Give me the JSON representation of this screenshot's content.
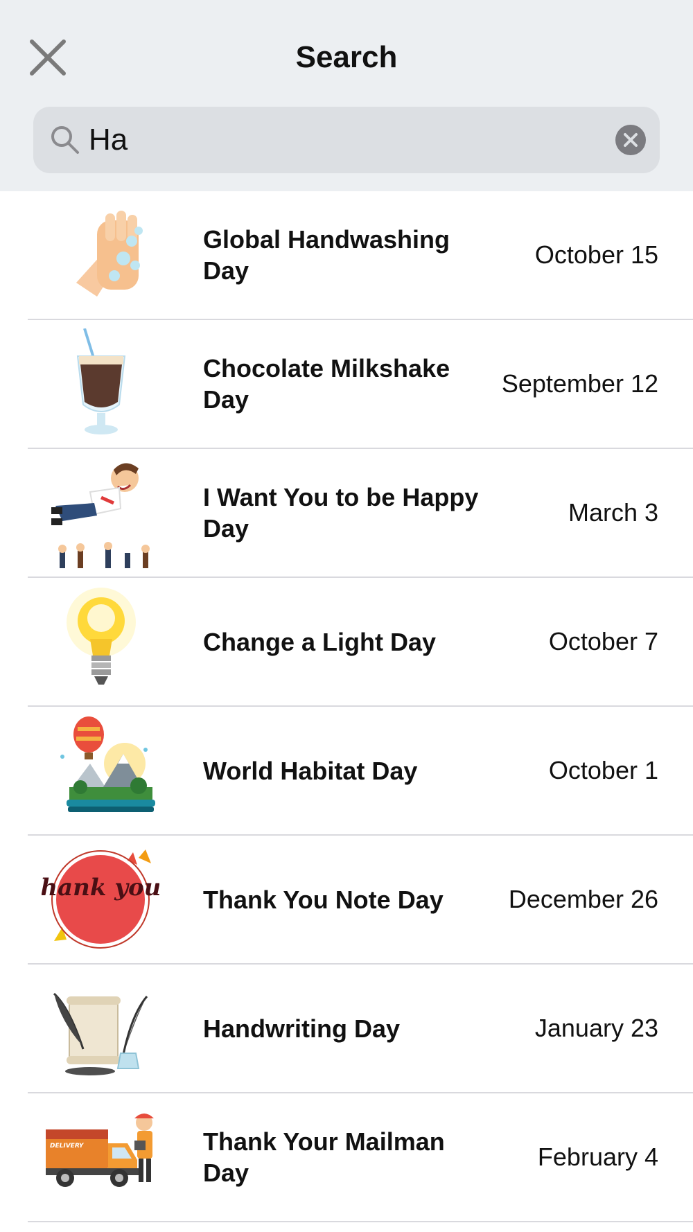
{
  "header": {
    "title": "Search",
    "close_icon": "close-icon"
  },
  "search": {
    "icon": "search-icon",
    "value": "Ha",
    "clear_icon": "clear-circle-icon"
  },
  "results": [
    {
      "name": "Global Handwashing Day",
      "date": "October 15",
      "icon": "handwashing-hands-icon"
    },
    {
      "name": "Chocolate Milkshake Day",
      "date": "September 12",
      "icon": "milkshake-glass-icon"
    },
    {
      "name": "I Want You to be Happy Day",
      "date": "March 3",
      "icon": "happy-man-thrown-icon"
    },
    {
      "name": "Change a Light Day",
      "date": "October 7",
      "icon": "lightbulb-icon"
    },
    {
      "name": "World Habitat Day",
      "date": "October 1",
      "icon": "habitat-island-icon"
    },
    {
      "name": "Thank You Note Day",
      "date": "December 26",
      "icon": "thank-you-badge-icon"
    },
    {
      "name": "Handwriting Day",
      "date": "January 23",
      "icon": "quill-scroll-icon"
    },
    {
      "name": "Thank Your Mailman Day",
      "date": "February 4",
      "icon": "delivery-truck-icon"
    }
  ],
  "colors": {
    "header_bg": "#eceff2",
    "search_bg": "#dcdfe3",
    "divider": "#d9d9de"
  },
  "art_text": {
    "thank_you": "thank you!",
    "delivery": "DELIVERY"
  }
}
